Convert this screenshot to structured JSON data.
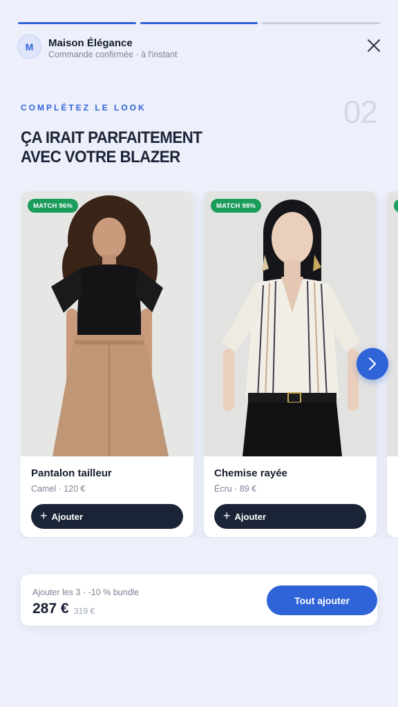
{
  "progress": {
    "segments_total": 3,
    "segments_done": 2
  },
  "header": {
    "avatar_initial": "M",
    "brand": "Maison Élégance",
    "subtitle": "Commande confirmée · à l'instant"
  },
  "section": {
    "eyebrow": "COMPLÉTEZ LE LOOK",
    "step": "02",
    "title_line1": "ÇA IRAIT PARFAITEMENT",
    "title_line2": "AVEC VOTRE BLAZER"
  },
  "products": [
    {
      "badge": "MATCH 96%",
      "name": "Pantalon tailleur",
      "meta": "Camel · 120 €",
      "button": "Ajouter"
    },
    {
      "badge": "MATCH 98%",
      "name": "Chemise rayée",
      "meta": "Écru · 89 €",
      "button": "Ajouter"
    }
  ],
  "bundle": {
    "label": "Ajouter les 3 · -10 % bundle",
    "price": "287 €",
    "old_price": "319 €",
    "button": "Tout ajouter"
  },
  "colors": {
    "accent": "#2f63d8",
    "dark": "#1b2336",
    "match": "#1a9c5b",
    "background": "#edf0fb"
  }
}
